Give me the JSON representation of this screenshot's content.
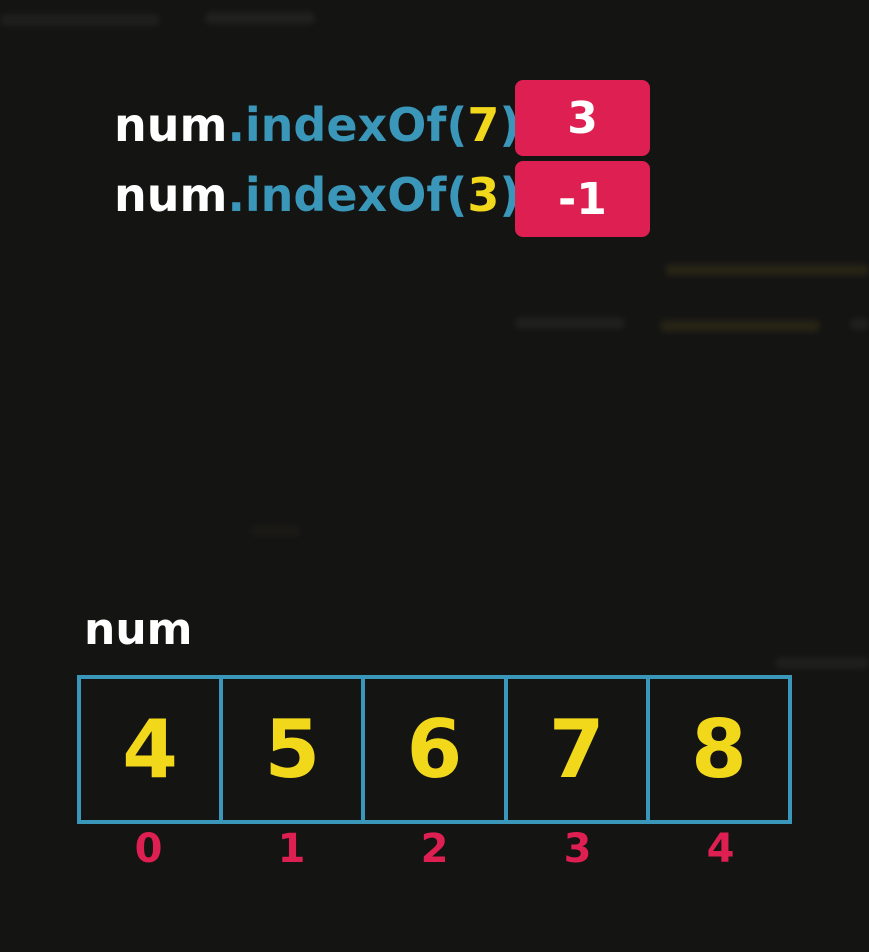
{
  "expressions": [
    {
      "object": "num",
      "method": ".indexOf(",
      "argument": "7",
      "close": ")",
      "result": "3"
    },
    {
      "object": "num",
      "method": ".indexOf(",
      "argument": "3",
      "close": ")",
      "result": "-1"
    }
  ],
  "array": {
    "label": "num",
    "values": [
      "4",
      "5",
      "6",
      "7",
      "8"
    ],
    "indices": [
      "0",
      "1",
      "2",
      "3",
      "4"
    ]
  },
  "colors": {
    "background": "#141413",
    "object": "#ffffff",
    "method": "#3a97b9",
    "argument": "#f1d81b",
    "result_badge": "#de1f51",
    "array_border": "#3a97b9",
    "array_value": "#f1d81b",
    "index": "#de1f51"
  }
}
